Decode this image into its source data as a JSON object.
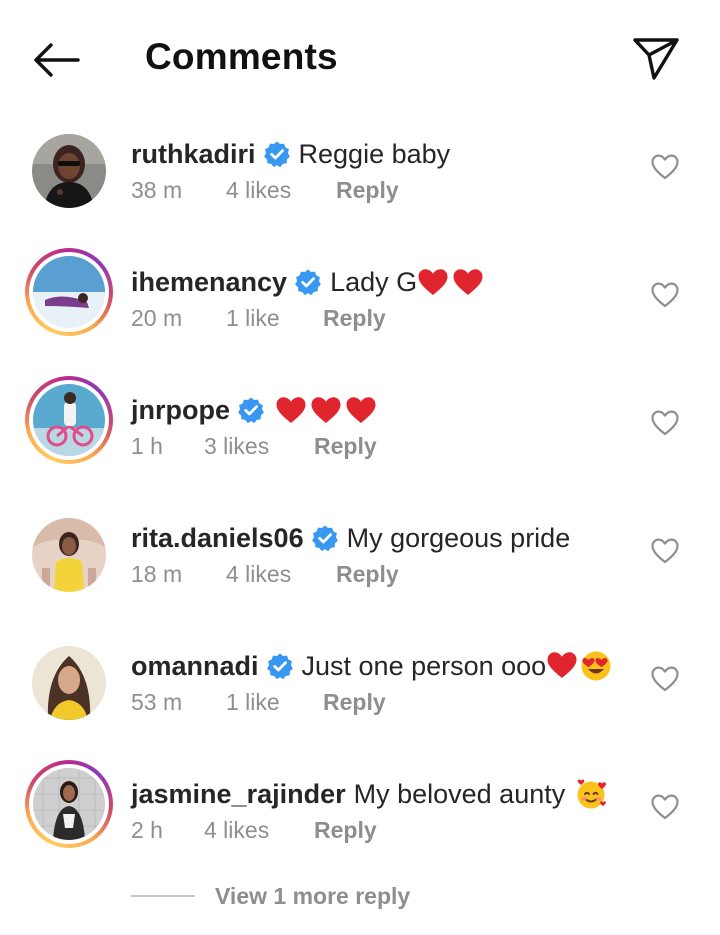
{
  "header": {
    "title": "Comments",
    "back_icon": "arrow-left-icon",
    "send_icon": "paper-plane-icon"
  },
  "colors": {
    "verified_blue": "#3897f0",
    "meta_gray": "#8e8e8e",
    "heart_red": "#e0252e",
    "text_dark": "#262626"
  },
  "comments": [
    {
      "username": "ruthkadiri",
      "verified": true,
      "text": "Reggie baby",
      "emojis": "",
      "time": "38 m",
      "likes": "4 likes",
      "reply": "Reply",
      "story_ring": false
    },
    {
      "username": "ihemenancy",
      "verified": true,
      "text": "Lady G",
      "emojis": "❤❤",
      "time": "20 m",
      "likes": "1 like",
      "reply": "Reply",
      "story_ring": true
    },
    {
      "username": "jnrpope",
      "verified": true,
      "text": "",
      "emojis": "❤❤❤",
      "time": "1 h",
      "likes": "3 likes",
      "reply": "Reply",
      "story_ring": true
    },
    {
      "username": "rita.daniels06",
      "verified": true,
      "text": "My gorgeous pride",
      "emojis": "",
      "time": "18 m",
      "likes": "4 likes",
      "reply": "Reply",
      "story_ring": false
    },
    {
      "username": "omannadi",
      "verified": true,
      "text": "Just one person ooo",
      "emojis": "❤😍",
      "time": "53 m",
      "likes": "1 like",
      "reply": "Reply",
      "story_ring": false
    },
    {
      "username": "jasmine_rajinder",
      "verified": false,
      "text": "My beloved aunty",
      "emojis": "🥰",
      "time": "2 h",
      "likes": "4 likes",
      "reply": "Reply",
      "story_ring": true
    }
  ],
  "more_replies": "View 1 more reply"
}
